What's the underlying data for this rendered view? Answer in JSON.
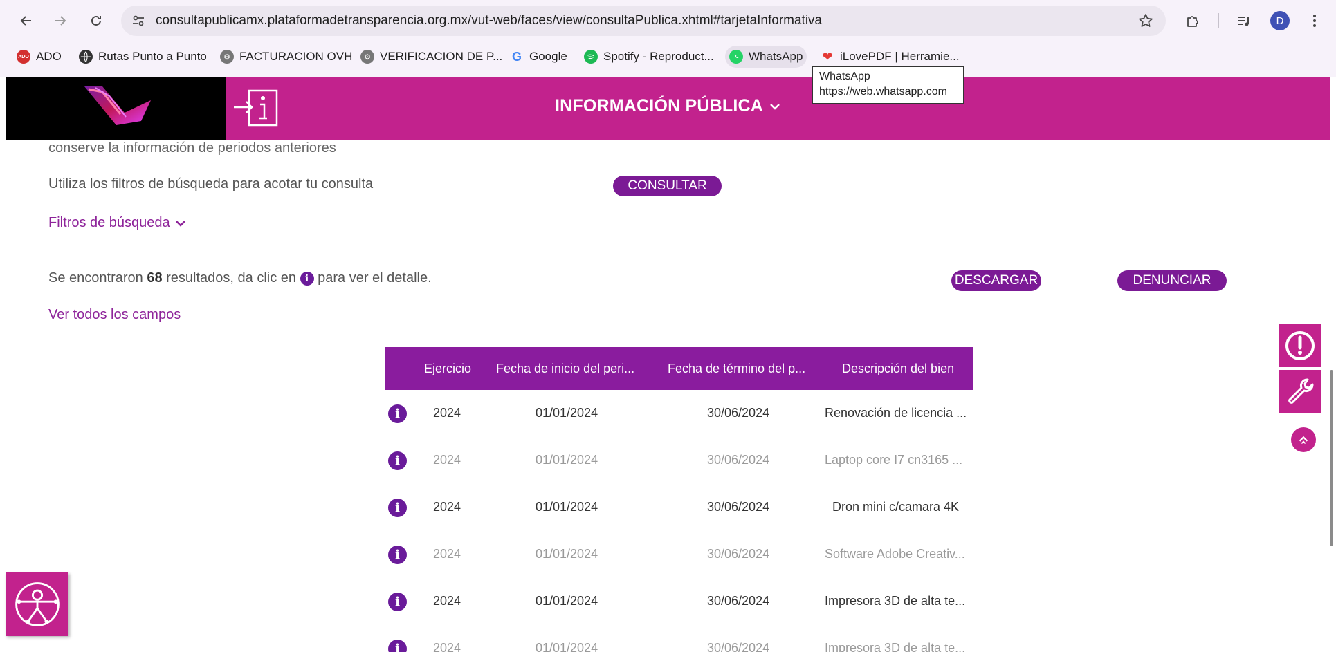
{
  "browser": {
    "url": "consultapublicamx.plataformadetransparencia.org.mx/vut-web/faces/view/consultaPublica.xhtml#tarjetaInformativa",
    "profile_initial": "D",
    "bookmarks": [
      {
        "label": "ADO",
        "icon": "ado-icon",
        "color": "#d32f2f"
      },
      {
        "label": "Rutas Punto a Punto",
        "icon": "globe-icon",
        "color": "#444444"
      },
      {
        "label": "FACTURACION OVH",
        "icon": "gear-icon",
        "color": "#666666"
      },
      {
        "label": "VERIFICACION DE P...",
        "icon": "gear-icon",
        "color": "#666666"
      },
      {
        "label": "Google",
        "icon": "google-icon",
        "color": "#4285f4"
      },
      {
        "label": "Spotify - Reproduct...",
        "icon": "spotify-icon",
        "color": "#1db954"
      },
      {
        "label": "WhatsApp",
        "icon": "whatsapp-icon",
        "color": "#25d366"
      },
      {
        "label": "iLovePDF | Herramie...",
        "icon": "ilovepdf-icon",
        "color": "#e53935"
      }
    ],
    "tooltip": {
      "title": "WhatsApp",
      "url": "https://web.whatsapp.com"
    }
  },
  "header": {
    "title": "INFORMACIÓN PÚBLICA",
    "bg_color": "#c2228d"
  },
  "content": {
    "partial_text": "conserve la información de periodos anteriores",
    "filter_hint": "Utiliza los filtros de búsqueda para acotar tu consulta",
    "consult_button": "CONSULTAR",
    "filters_link": "Filtros de búsqueda",
    "results_prefix": "Se encontraron ",
    "results_count": "68",
    "results_mid": " resultados, da clic en ",
    "results_suffix": " para ver el detalle.",
    "download_button": "DESCARGAR",
    "report_button": "DENUNCIAR",
    "view_all_link": "Ver todos los campos"
  },
  "table": {
    "columns": [
      "Ejercicio",
      "Fecha de inicio del peri...",
      "Fecha de término del p...",
      "Descripción del bien"
    ],
    "rows": [
      {
        "ejercicio": "2024",
        "inicio": "01/01/2024",
        "termino": "30/06/2024",
        "descripcion": "Renovación de licencia ..."
      },
      {
        "ejercicio": "2024",
        "inicio": "01/01/2024",
        "termino": "30/06/2024",
        "descripcion": "Laptop core I7 cn3165 ..."
      },
      {
        "ejercicio": "2024",
        "inicio": "01/01/2024",
        "termino": "30/06/2024",
        "descripcion": "Dron mini c/camara 4K"
      },
      {
        "ejercicio": "2024",
        "inicio": "01/01/2024",
        "termino": "30/06/2024",
        "descripcion": "Software Adobe Creativ..."
      },
      {
        "ejercicio": "2024",
        "inicio": "01/01/2024",
        "termino": "30/06/2024",
        "descripcion": "Impresora 3D de alta te..."
      },
      {
        "ejercicio": "2024",
        "inicio": "01/01/2024",
        "termino": "30/06/2024",
        "descripcion": "Impresora 3D de alta te..."
      }
    ]
  }
}
